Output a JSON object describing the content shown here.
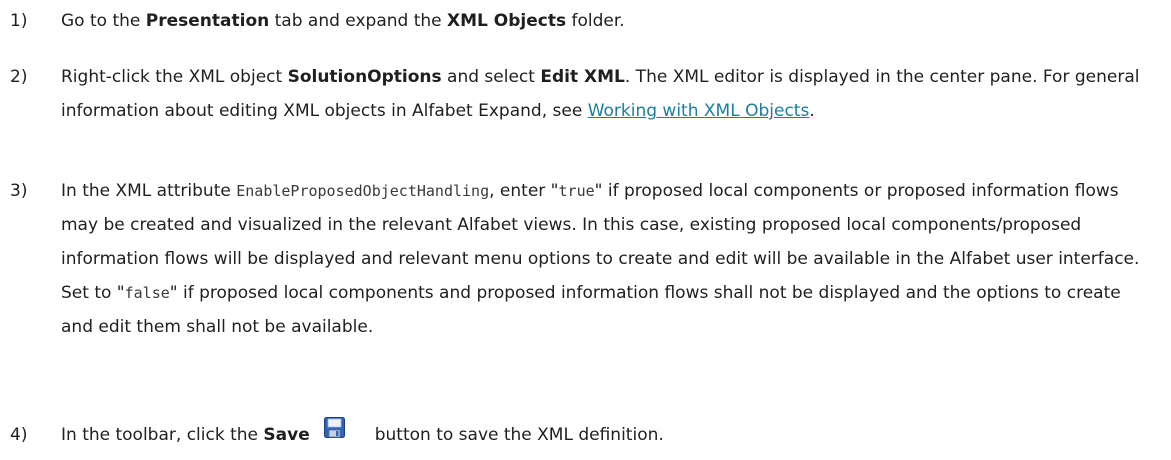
{
  "steps": [
    {
      "number": "1)",
      "t1": "Go to the ",
      "b1": "Presentation",
      "t2": " tab and expand the ",
      "b2": "XML Objects",
      "t3": " folder."
    },
    {
      "number": "2)",
      "t1": "Right-click the XML object ",
      "b1": "SolutionOptions",
      "t2": " and select ",
      "b2": "Edit XML",
      "t3": ". The XML editor is displayed in the center pane. For general information about editing XML objects in Alfabet Expand, see ",
      "link": "Working with XML Objects",
      "t4": "."
    },
    {
      "number": "3)",
      "t1": "In the XML attribute ",
      "code1": "EnableProposedObjectHandling",
      "t2": ", enter \"",
      "code2": "true",
      "t3": "\" if proposed local components or proposed information flows may be created and visualized in the relevant Alfabet views. In this case, existing proposed local components/proposed information flows will be displayed and relevant menu options to create and edit will be available in the Alfabet user interface. Set to \"",
      "code3": "false",
      "t4": "\" if proposed local components and proposed information flows shall not be displayed and the options to create and edit them shall not be available."
    },
    {
      "number": "4)",
      "t1": "In the toolbar, click the ",
      "b1": "Save",
      "icon": "save-icon",
      "t2": "button to save the XML definition."
    }
  ],
  "colors": {
    "text": "#1f1f1f",
    "link": "#1a7f9c",
    "save_icon_blue": "#2e63b8"
  }
}
